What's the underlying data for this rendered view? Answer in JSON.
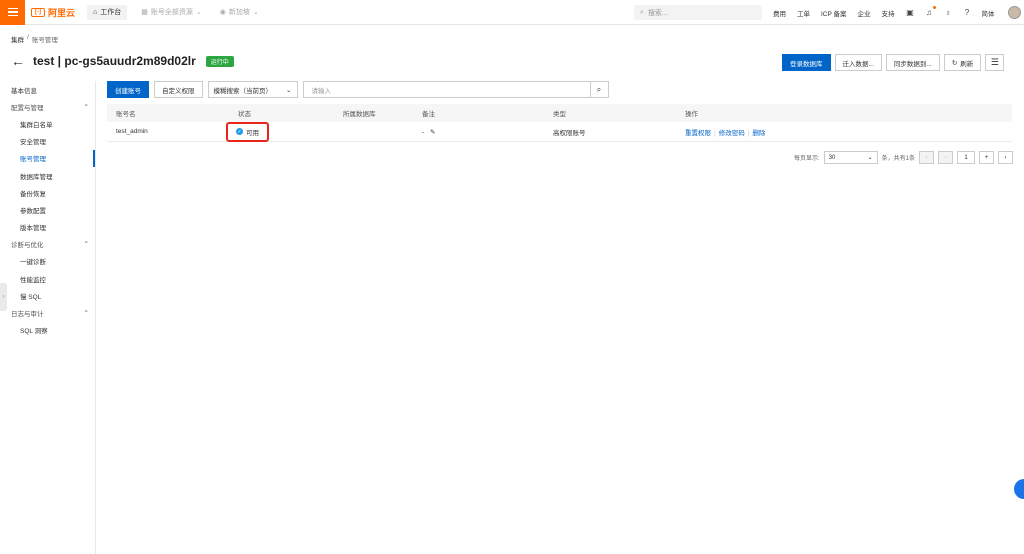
{
  "topbar": {
    "logo_text": "阿里云",
    "workbench": "工作台",
    "resource_dropdown": "账号全部资源",
    "region_dropdown": "新加坡",
    "search_placeholder": "搜索...",
    "links": [
      "费用",
      "工单",
      "ICP 备案",
      "企业",
      "支持"
    ],
    "language": "简体"
  },
  "breadcrumb": [
    "集群",
    "/",
    "账号管理"
  ],
  "header": {
    "title": "test | pc-gs5auudr2m89d02lr",
    "status": "运行中",
    "buttons": {
      "login_db": "登录数据库",
      "migrate": "迁入数据...",
      "sync": "同步数据到...",
      "refresh": "刷新"
    }
  },
  "sidebar": {
    "items": [
      {
        "label": "基本信息",
        "type": "top"
      },
      {
        "label": "配置与管理",
        "type": "group"
      },
      {
        "label": "集群白名单",
        "type": "sub"
      },
      {
        "label": "安全管理",
        "type": "sub"
      },
      {
        "label": "账号管理",
        "type": "sub",
        "active": true
      },
      {
        "label": "数据库管理",
        "type": "sub"
      },
      {
        "label": "备份恢复",
        "type": "sub"
      },
      {
        "label": "参数配置",
        "type": "sub"
      },
      {
        "label": "版本管理",
        "type": "sub"
      },
      {
        "label": "诊断与优化",
        "type": "group"
      },
      {
        "label": "一键诊断",
        "type": "sub"
      },
      {
        "label": "性能监控",
        "type": "sub"
      },
      {
        "label": "慢 SQL",
        "type": "sub"
      },
      {
        "label": "日志与审计",
        "type": "group"
      },
      {
        "label": "SQL 洞察",
        "type": "sub"
      }
    ]
  },
  "toolbar": {
    "create_account": "创建账号",
    "custom_permission": "自定义权限",
    "search_mode": "模糊搜索（当前页）",
    "search_placeholder": "请输入"
  },
  "table": {
    "headers": [
      "账号名",
      "状态",
      "所属数据库",
      "备注",
      "类型",
      "操作"
    ],
    "rows": [
      {
        "name": "test_admin",
        "status": "可用",
        "database": "",
        "remark": "-",
        "type": "高权限账号",
        "ops": [
          "重置权限",
          "修改密码",
          "删除"
        ]
      }
    ]
  },
  "pager": {
    "per_page_label": "每页显示:",
    "per_page": "30",
    "total": "条，共有1条",
    "page": "1"
  },
  "colors": {
    "brand": "#ff6a00",
    "primary": "#0064c8",
    "running": "#2da641",
    "highlight": "#e8261b"
  }
}
